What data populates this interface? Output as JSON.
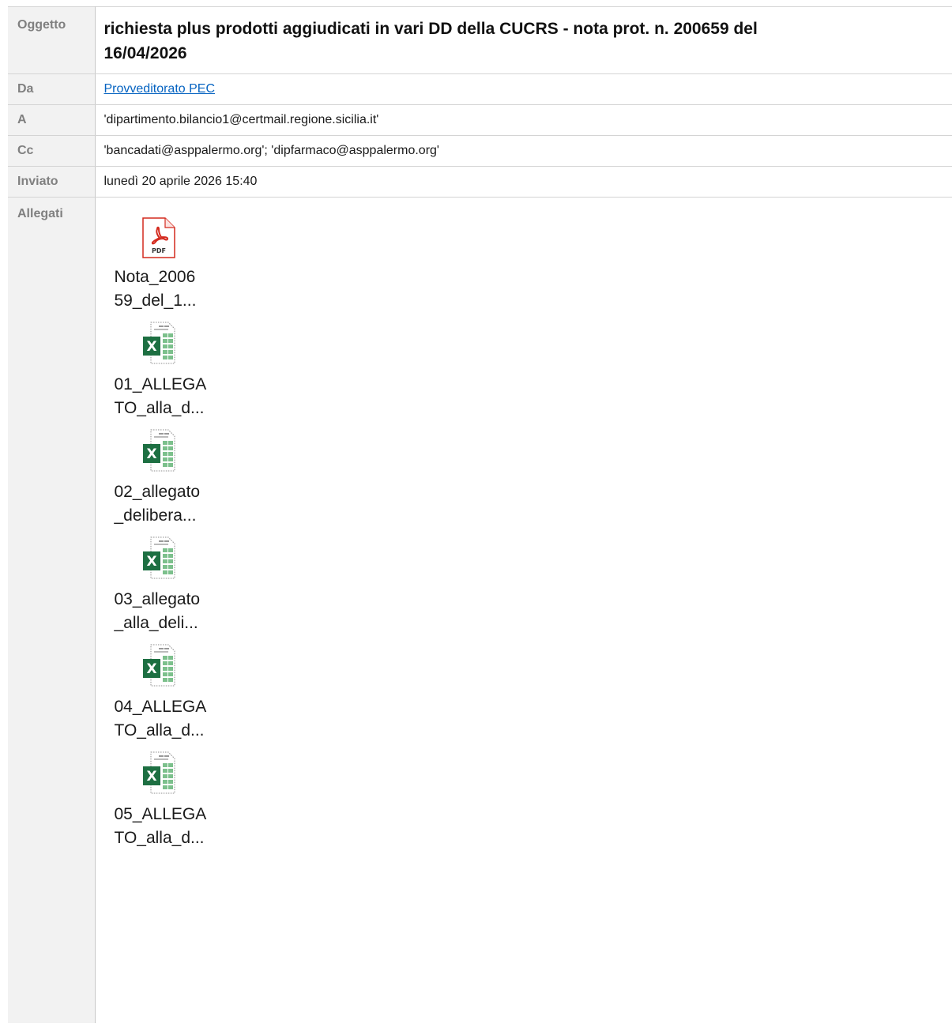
{
  "message": {
    "labels": {
      "subject": "Oggetto",
      "from": "Da",
      "to": "A",
      "cc": "Cc",
      "sent": "Inviato",
      "attachments": "Allegati"
    },
    "subject_line1": "richiesta plus prodotti aggiudicati in vari DD della CUCRS - nota prot. n. 200659 del",
    "subject_line2": "16/04/2026",
    "from": "Provveditorato PEC",
    "to": "'dipartimento.bilancio1@certmail.regione.sicilia.it'",
    "cc": "'bancadati@asppalermo.org'; 'dipfarmaco@asppalermo.org'",
    "sent": "lunedì 20 aprile 2026 15:40"
  },
  "attachments": [
    {
      "icon": "pdf-icon",
      "line1": "Nota_2006",
      "line2": "59_del_1..."
    },
    {
      "icon": "excel-icon",
      "line1": "01_ALLEGA",
      "line2": "TO_alla_d..."
    },
    {
      "icon": "excel-icon",
      "line1": "02_allegato",
      "line2": "_delibera..."
    },
    {
      "icon": "excel-icon",
      "line1": "03_allegato",
      "line2": "_alla_deli..."
    },
    {
      "icon": "excel-icon",
      "line1": "04_ALLEGA",
      "line2": "TO_alla_d..."
    },
    {
      "icon": "excel-icon",
      "line1": "05_ALLEGA",
      "line2": "TO_alla_d..."
    }
  ],
  "colors": {
    "label_bg": "#f2f2f2",
    "label_text": "#808080",
    "link": "#0563c1",
    "excel_green": "#1d6f42",
    "pdf_red": "#d42a1e"
  }
}
